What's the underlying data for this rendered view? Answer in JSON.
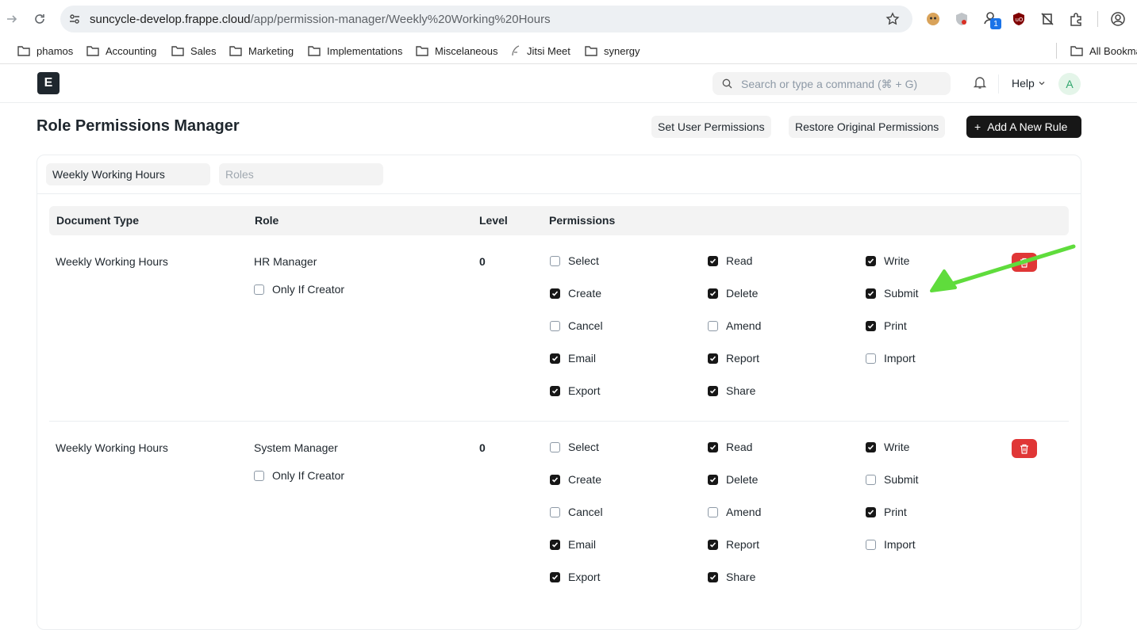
{
  "browser": {
    "url_host": "suncycle-develop.frappe.cloud",
    "url_path": "/app/permission-manager/Weekly%20Working%20Hours",
    "extension_badge": "1",
    "bookmarks": [
      {
        "label": "phamos",
        "icon": "folder-icon"
      },
      {
        "label": "Accounting",
        "icon": "folder-icon"
      },
      {
        "label": "Sales",
        "icon": "folder-icon"
      },
      {
        "label": "Marketing",
        "icon": "folder-icon"
      },
      {
        "label": "Implementations",
        "icon": "folder-icon"
      },
      {
        "label": "Miscelaneous",
        "icon": "folder-icon"
      },
      {
        "label": "Jitsi Meet",
        "icon": "feather-icon"
      },
      {
        "label": "synergy",
        "icon": "folder-icon"
      }
    ],
    "all_bookmarks": "All Bookma"
  },
  "navbar": {
    "logo_letter": "E",
    "search_placeholder": "Search or type a command (⌘ + G)",
    "help_label": "Help",
    "avatar_letter": "A"
  },
  "page": {
    "title": "Role Permissions Manager",
    "set_user_permissions": "Set User Permissions",
    "restore_original": "Restore Original Permissions",
    "add_rule_plus": "+",
    "add_rule": "Add A New Rule"
  },
  "filters": {
    "doctype_value": "Weekly Working Hours",
    "roles_placeholder": "Roles"
  },
  "table": {
    "headers": {
      "doctype": "Document Type",
      "role": "Role",
      "level": "Level",
      "permissions": "Permissions"
    },
    "rows": [
      {
        "doctype": "Weekly Working Hours",
        "role": "HR Manager",
        "level": "0",
        "only_if_creator": {
          "label": "Only If Creator",
          "checked": false
        },
        "permissions": [
          {
            "label": "Select",
            "checked": false
          },
          {
            "label": "Read",
            "checked": true
          },
          {
            "label": "Write",
            "checked": true
          },
          {
            "label": "Create",
            "checked": true
          },
          {
            "label": "Delete",
            "checked": true
          },
          {
            "label": "Submit",
            "checked": true
          },
          {
            "label": "Cancel",
            "checked": false
          },
          {
            "label": "Amend",
            "checked": false
          },
          {
            "label": "Print",
            "checked": true
          },
          {
            "label": "Email",
            "checked": true
          },
          {
            "label": "Report",
            "checked": true
          },
          {
            "label": "Import",
            "checked": false
          },
          {
            "label": "Export",
            "checked": true
          },
          {
            "label": "Share",
            "checked": true
          }
        ]
      },
      {
        "doctype": "Weekly Working Hours",
        "role": "System Manager",
        "level": "0",
        "only_if_creator": {
          "label": "Only If Creator",
          "checked": false
        },
        "permissions": [
          {
            "label": "Select",
            "checked": false
          },
          {
            "label": "Read",
            "checked": true
          },
          {
            "label": "Write",
            "checked": true
          },
          {
            "label": "Create",
            "checked": true
          },
          {
            "label": "Delete",
            "checked": true
          },
          {
            "label": "Submit",
            "checked": false
          },
          {
            "label": "Cancel",
            "checked": false
          },
          {
            "label": "Amend",
            "checked": false
          },
          {
            "label": "Print",
            "checked": true
          },
          {
            "label": "Email",
            "checked": true
          },
          {
            "label": "Report",
            "checked": true
          },
          {
            "label": "Import",
            "checked": false
          },
          {
            "label": "Export",
            "checked": true
          },
          {
            "label": "Share",
            "checked": true
          }
        ]
      }
    ]
  },
  "colors": {
    "primary": "#171717",
    "danger": "#e03636",
    "annotation_arrow": "#5fdc3c"
  }
}
